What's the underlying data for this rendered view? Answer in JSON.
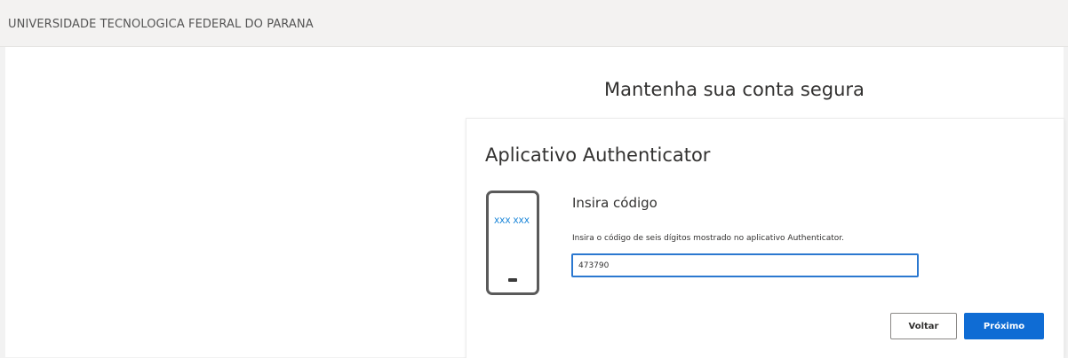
{
  "header": {
    "org_name": "UNIVERSIDADE TECNOLOGICA FEDERAL DO PARANA"
  },
  "page": {
    "title": "Mantenha sua conta segura"
  },
  "card": {
    "title": "Aplicativo Authenticator",
    "phone_code": "XXX XXX",
    "section_title": "Insira código",
    "instructions": "Insira o código de seis dígitos mostrado no aplicativo Authenticator.",
    "code_input": {
      "value": "473790"
    },
    "back_label": "Voltar",
    "next_label": "Próximo"
  },
  "colors": {
    "accent": "#0f6cd4",
    "input_border": "#2b78d0",
    "phone_code": "#0078d4"
  },
  "icons": {
    "phone": "smartphone-icon"
  }
}
